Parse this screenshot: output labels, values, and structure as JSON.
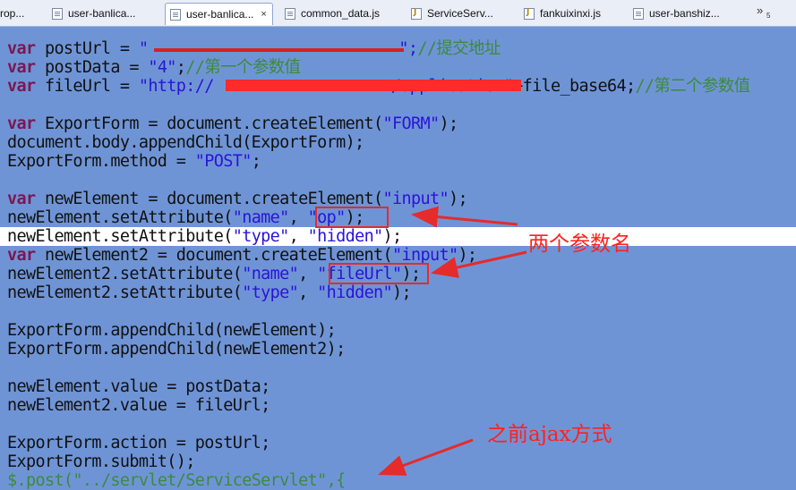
{
  "tabs": [
    {
      "label": "rop...",
      "icon": "file-icon",
      "active": false
    },
    {
      "label": "user-banlica...",
      "icon": "file-icon",
      "active": false
    },
    {
      "label": "user-banlica...",
      "icon": "file-icon",
      "active": true
    },
    {
      "label": "common_data.js",
      "icon": "file-icon",
      "active": false
    },
    {
      "label": "ServiceServ...",
      "icon": "java-file-icon",
      "active": false
    },
    {
      "label": "fankuixinxi.js",
      "icon": "java-file-icon",
      "active": false
    },
    {
      "label": "user-banshiz...",
      "icon": "file-icon",
      "active": false
    }
  ],
  "tab_close": "×",
  "overflow": {
    "chevron": "»",
    "count": "5"
  },
  "code": {
    "l1": {
      "kw": "var",
      "a": " postUrl = ",
      "b": "\"",
      "c": "\";",
      "d": "//提交地址"
    },
    "l2": {
      "kw": "var",
      "a": " postData = ",
      "b": "\"4\"",
      "c": ";",
      "d": "//第一个参数值"
    },
    "l3": {
      "kw": "var",
      "a": " fileUrl = ",
      "b": "\"http://",
      "e": "/application\"",
      "c": "+file_base64;",
      "d": "//第二个参数值"
    },
    "l5": {
      "kw": "var",
      "a": " ExportForm = document.createElement(",
      "b": "\"FORM\"",
      "c": ");"
    },
    "l6": "document.body.appendChild(ExportForm);",
    "l7": {
      "a": "ExportForm.method = ",
      "b": "\"POST\"",
      "c": ";"
    },
    "l9": {
      "kw": "var",
      "a": " newElement = document.createElement(",
      "b": "\"input\"",
      "c": ");"
    },
    "l10": {
      "a": "newElement.setAttribute(",
      "b": "\"name\"",
      "c": ", ",
      "e": "\"op\"",
      "f": ");"
    },
    "l11": {
      "a": "newElement.setAttribute(",
      "b": "\"type\"",
      "c": ", ",
      "e": "\"hidden\"",
      "f": ");"
    },
    "l12": {
      "kw": "var",
      "a": " newElement2 = document.createElement(",
      "b": "\"input\"",
      "c": ");"
    },
    "l13": {
      "a": "newElement2.setAttribute(",
      "b": "\"name\"",
      "c": ", ",
      "e": "\"fileUrl\"",
      "f": ");"
    },
    "l14": {
      "a": "newElement2.setAttribute(",
      "b": "\"type\"",
      "c": ", ",
      "e": "\"hidden\"",
      "f": ");"
    },
    "l16": "ExportForm.appendChild(newElement);",
    "l17": "ExportForm.appendChild(newElement2);",
    "l19": "newElement.value = postData;",
    "l20": "newElement2.value = fileUrl;",
    "l22": "ExportForm.action = postUrl;",
    "l23": "ExportForm.submit();",
    "l24": {
      "a": "$.post(",
      "b": "\"../servlet/ServiceServlet\"",
      "c": ",{"
    }
  },
  "annotations": {
    "param_names": "两个参数名",
    "old_ajax": "之前ajax方式"
  },
  "colors": {
    "editor_bg": "#6f94d6",
    "current_line": "#ffffff",
    "keyword": "#7b1750",
    "string": "#2a14d6",
    "comment": "#3d8a3d",
    "annotation_red": "#ff2020"
  }
}
